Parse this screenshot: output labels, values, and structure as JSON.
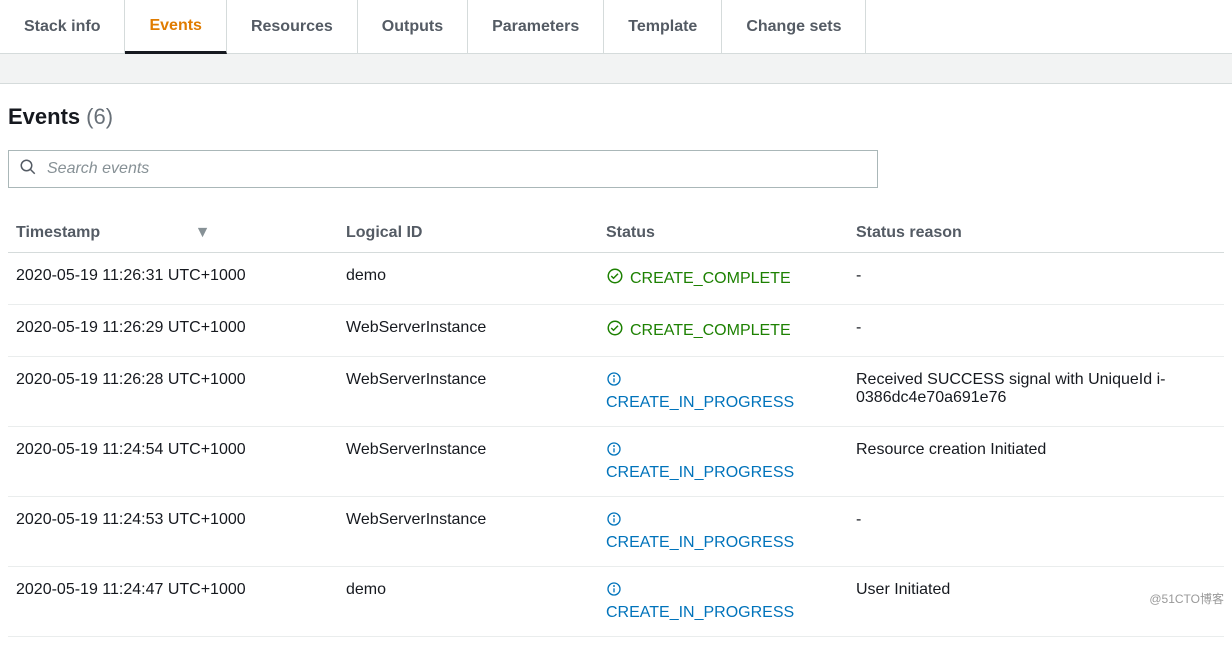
{
  "tabs": [
    {
      "label": "Stack info",
      "active": false
    },
    {
      "label": "Events",
      "active": true
    },
    {
      "label": "Resources",
      "active": false
    },
    {
      "label": "Outputs",
      "active": false
    },
    {
      "label": "Parameters",
      "active": false
    },
    {
      "label": "Template",
      "active": false
    },
    {
      "label": "Change sets",
      "active": false
    }
  ],
  "header": {
    "title": "Events",
    "count": "(6)"
  },
  "search": {
    "placeholder": "Search events"
  },
  "columns": {
    "timestamp": "Timestamp",
    "logical_id": "Logical ID",
    "status": "Status",
    "status_reason": "Status reason"
  },
  "rows": [
    {
      "timestamp": "2020-05-19 11:26:31 UTC+1000",
      "logical_id": "demo",
      "status_kind": "complete",
      "status": "CREATE_COMPLETE",
      "reason": "-"
    },
    {
      "timestamp": "2020-05-19 11:26:29 UTC+1000",
      "logical_id": "WebServerInstance",
      "status_kind": "complete",
      "status": "CREATE_COMPLETE",
      "reason": "-"
    },
    {
      "timestamp": "2020-05-19 11:26:28 UTC+1000",
      "logical_id": "WebServerInstance",
      "status_kind": "progress",
      "status": "CREATE_IN_PROGRESS",
      "reason": "Received SUCCESS signal with UniqueId i-0386dc4e70a691e76"
    },
    {
      "timestamp": "2020-05-19 11:24:54 UTC+1000",
      "logical_id": "WebServerInstance",
      "status_kind": "progress",
      "status": "CREATE_IN_PROGRESS",
      "reason": "Resource creation Initiated"
    },
    {
      "timestamp": "2020-05-19 11:24:53 UTC+1000",
      "logical_id": "WebServerInstance",
      "status_kind": "progress",
      "status": "CREATE_IN_PROGRESS",
      "reason": "-"
    },
    {
      "timestamp": "2020-05-19 11:24:47 UTC+1000",
      "logical_id": "demo",
      "status_kind": "progress",
      "status": "CREATE_IN_PROGRESS",
      "reason": "User Initiated"
    }
  ],
  "watermark": "@51CTO博客"
}
